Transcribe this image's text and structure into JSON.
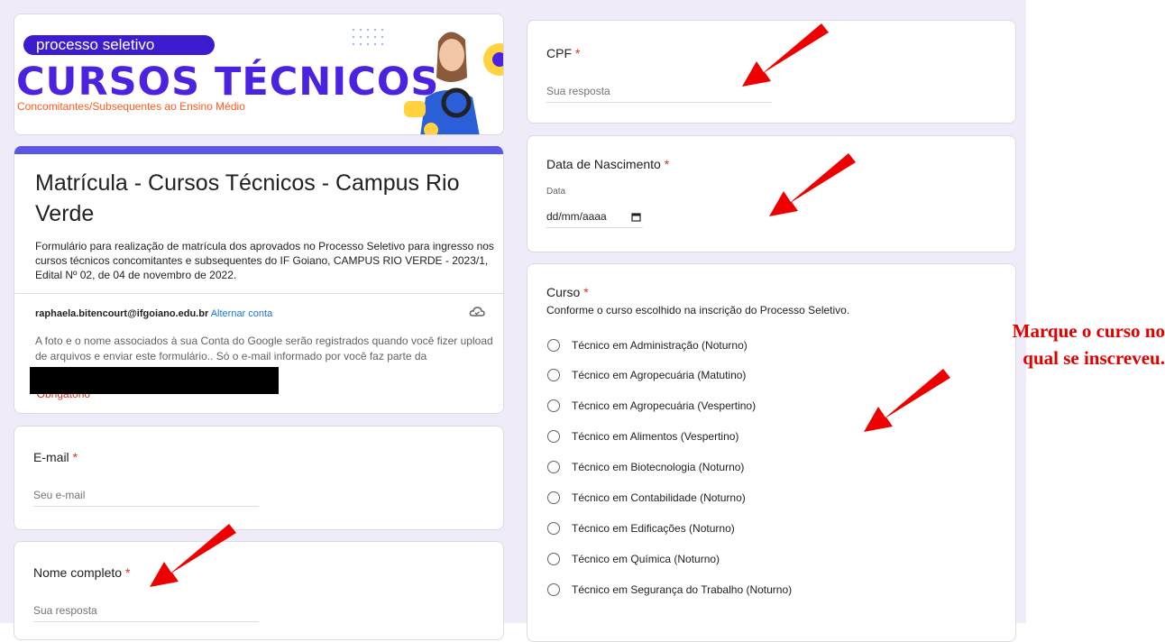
{
  "banner": {
    "pill_text": "processo seletivo",
    "title": "CURSOS TÉCNICOS",
    "subtitle": "Concomitantes/Subsequentes ao Ensino Médio"
  },
  "form": {
    "title": "Matrícula - Cursos Técnicos - Campus Rio Verde",
    "description": "Formulário para realização de matrícula dos aprovados no Processo Seletivo para ingresso nos cursos técnicos concomitantes e subsequentes do IF Goiano, CAMPUS RIO VERDE - 2023/1, Edital Nº 02, de 04 de novembro de 2022.",
    "account_email": "raphaela.bitencourt@ifgoiano.edu.br",
    "switch_account": "Alternar conta",
    "notice": "A foto e o nome associados à sua Conta do Google serão registrados quando você fizer upload de arquivos e enviar este formulário.. Só o e-mail informado por você faz parte da",
    "required_note": "*Obrigatório"
  },
  "questions": {
    "email": {
      "label": "E-mail",
      "required": "*",
      "placeholder": "Seu e-mail"
    },
    "name": {
      "label": "Nome completo",
      "required": "*",
      "placeholder": "Sua resposta"
    },
    "cpf": {
      "label": "CPF",
      "required": "*",
      "placeholder": "Sua resposta"
    },
    "birth": {
      "label": "Data de Nascimento",
      "required": "*",
      "sublabel": "Data",
      "value": "dd/mm/aaaa"
    },
    "course": {
      "label": "Curso",
      "required": "*",
      "help": "Conforme o curso escolhido na inscrição do Processo Seletivo.",
      "options": [
        "Técnico em Administração (Noturno)",
        "Técnico em Agropecuária (Matutino)",
        "Técnico em Agropecuária (Vespertino)",
        "Técnico em Alimentos (Vespertino)",
        "Técnico em Biotecnologia (Noturno)",
        "Técnico em Contabilidade (Noturno)",
        "Técnico em Edificações (Noturno)",
        "Técnico em Química (Noturno)",
        "Técnico em Segurança do Trabalho (Noturno)"
      ]
    }
  },
  "annotation": {
    "line1": "Marque o curso no",
    "line2": "qual se inscreveu."
  },
  "colors": {
    "arrow": "#ee0000",
    "accent": "#5c56e6",
    "required": "#d93025",
    "page_bg": "#f0ebf8"
  }
}
